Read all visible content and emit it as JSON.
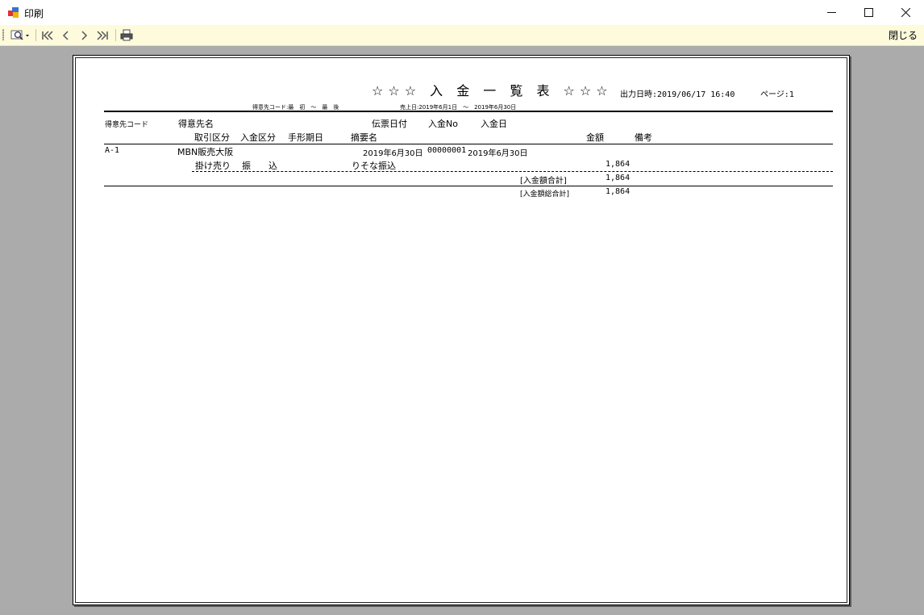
{
  "window": {
    "title": "印刷",
    "controls": {
      "minimize": "—",
      "maximize": "☐",
      "close": "✕"
    }
  },
  "toolbar": {
    "icons": [
      "zoom-icon",
      "first-page-icon",
      "prev-page-icon",
      "next-page-icon",
      "last-page-icon",
      "print-icon"
    ],
    "close_label": "閉じる"
  },
  "report": {
    "title": "☆☆☆ 入 金 一 覧 表 ☆☆☆",
    "output_datetime": "出力日時:2019/06/17 16:40",
    "page": "ページ:1",
    "condition_customer": "得意先コード:最　初　～　最　後",
    "condition_sales_date": "売上日:2019年6月1日　～　2019年6月30日",
    "headers": {
      "customer_code": "得意先コード",
      "customer_name": "得意先名",
      "slip_date": "伝票日付",
      "deposit_no": "入金No",
      "deposit_date": "入金日",
      "transaction_type": "取引区分",
      "deposit_type": "入金区分",
      "bill_due_date": "手形期日",
      "summary": "摘要名",
      "amount": "金額",
      "remarks": "備考"
    },
    "rows": [
      {
        "customer_code": "A-1",
        "customer_name": "MBN販売大阪",
        "slip_date": "2019年6月30日",
        "deposit_no": "00000001",
        "deposit_date": "2019年6月30日",
        "transaction_type": "掛け売り",
        "deposit_type": "振　　込",
        "summary": "りそな振込",
        "amount": "1,864"
      }
    ],
    "subtotal_label": "[入金額合計]",
    "subtotal_value": "1,864",
    "grandtotal_label": "[入金額総合計]",
    "grandtotal_value": "1,864"
  }
}
